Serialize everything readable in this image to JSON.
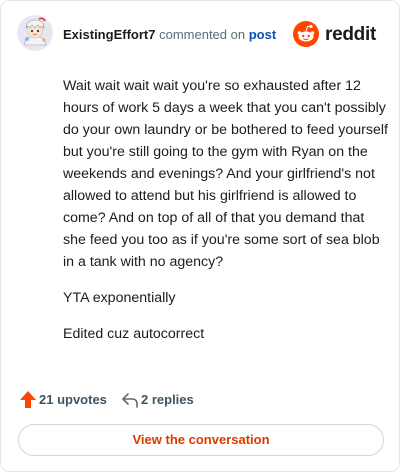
{
  "header": {
    "username": "ExistingEffort7",
    "commented_text": "commented on",
    "post_link": "post",
    "brand_name": "reddit"
  },
  "icons": {
    "avatar": "avatar-icon",
    "brand": "reddit-logo-icon",
    "upvote": "upvote-arrow-icon",
    "reply": "reply-arrow-icon"
  },
  "comment": {
    "paragraphs": [
      "Wait wait wait wait you're so exhausted after 12 hours of work 5 days a week that you can't possibly do your own laundry or be bothered to feed yourself but you're still going to the gym with Ryan on the weekends and evenings? And your girlfriend's not allowed to attend but his girlfriend is allowed to come? And on top of all of that you demand that she feed you too as if you're some sort of sea blob in a tank with no agency?",
      "YTA exponentially",
      "Edited cuz autocorrect"
    ]
  },
  "stats": {
    "upvotes": "21 upvotes",
    "replies": "2 replies"
  },
  "actions": {
    "view_conversation": "View the conversation"
  },
  "colors": {
    "brand_orange": "#ff4500",
    "link_blue": "#0a53b3",
    "button_text": "#d93a00"
  }
}
